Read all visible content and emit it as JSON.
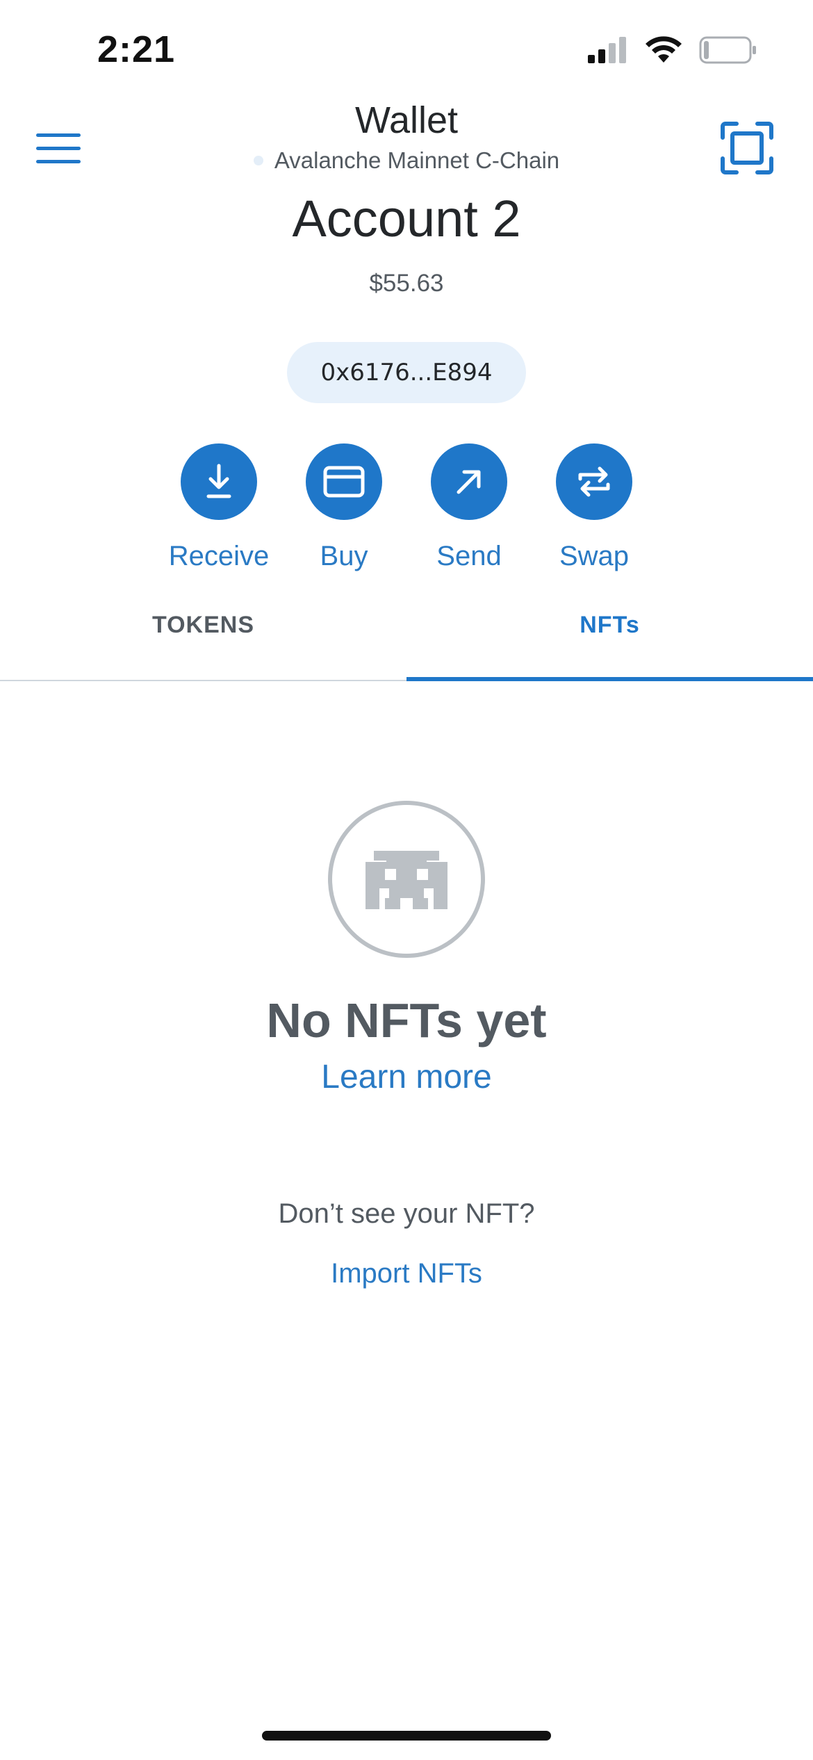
{
  "status_bar": {
    "time": "2:21"
  },
  "header": {
    "title": "Wallet",
    "network": "Avalanche Mainnet C-Chain",
    "menu_icon": "hamburger-menu-icon",
    "scan_icon": "qr-scan-icon"
  },
  "account": {
    "name": "Account 2",
    "balance": "$55.63",
    "address": "0x6176...E894"
  },
  "actions": [
    {
      "label": "Receive",
      "icon": "download-arrow-icon"
    },
    {
      "label": "Buy",
      "icon": "credit-card-icon"
    },
    {
      "label": "Send",
      "icon": "arrow-up-right-icon"
    },
    {
      "label": "Swap",
      "icon": "swap-arrows-icon"
    }
  ],
  "tabs": {
    "tokens": "TOKENS",
    "nfts": "NFTs",
    "active": "NFTs"
  },
  "empty_state": {
    "icon": "space-invader-icon",
    "title": "No NFTs yet",
    "learn_more": "Learn more",
    "prompt": "Don’t see your NFT?",
    "import": "Import NFTs"
  },
  "colors": {
    "accent": "#1f77c9",
    "text_primary": "#24272a",
    "text_secondary": "#535a61",
    "pill_bg": "#e7f1fb"
  }
}
